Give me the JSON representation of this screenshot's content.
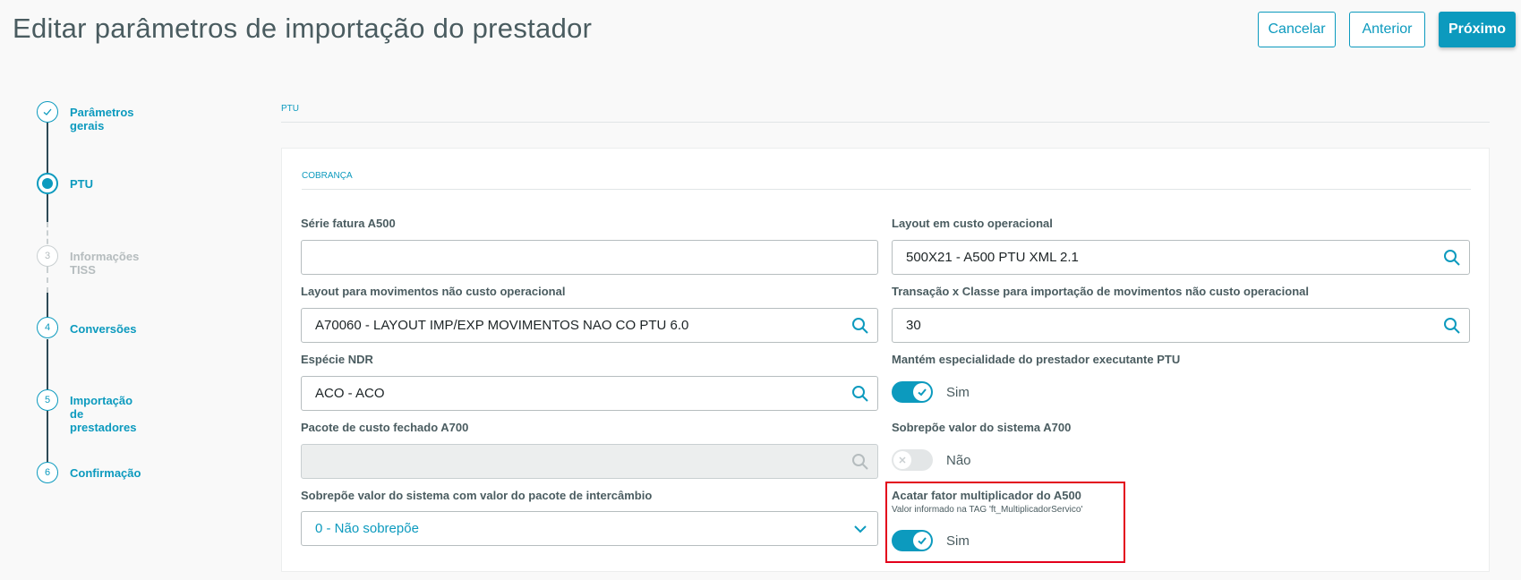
{
  "header": {
    "title": "Editar parâmetros de importação do prestador",
    "cancel_label": "Cancelar",
    "previous_label": "Anterior",
    "next_label": "Próximo"
  },
  "stepper": {
    "steps": [
      {
        "number": "✓",
        "label": "Parâmetros gerais",
        "state": "done"
      },
      {
        "number": "",
        "label": "PTU",
        "state": "active"
      },
      {
        "number": "3",
        "label": "Informações TISS",
        "state": "disabled"
      },
      {
        "number": "4",
        "label": "Conversões",
        "state": "pending"
      },
      {
        "number": "5",
        "label": "Importação de prestadores",
        "state": "pending"
      },
      {
        "number": "6",
        "label": "Confirmação",
        "state": "pending"
      }
    ]
  },
  "section": {
    "title": "PTU",
    "card_title": "COBRANÇA"
  },
  "form": {
    "serie_fatura": {
      "label": "Série fatura A500",
      "value": ""
    },
    "layout_custo": {
      "label": "Layout em custo operacional",
      "value": "500X21 - A500 PTU XML 2.1"
    },
    "layout_nao_custo": {
      "label": "Layout para movimentos não custo operacional",
      "value": "A70060 - LAYOUT IMP/EXP MOVIMENTOS NAO CO PTU 6.0"
    },
    "transacao_classe": {
      "label": "Transação x Classe para importação de movimentos não custo operacional",
      "value": "30"
    },
    "especie_ndr": {
      "label": "Espécie NDR",
      "value": "ACO - ACO"
    },
    "mantem_especialidade": {
      "label": "Mantém especialidade do prestador executante PTU",
      "state_label": "Sim"
    },
    "pacote_custo": {
      "label": "Pacote de custo fechado A700",
      "value": ""
    },
    "sobrepoe_a700": {
      "label": "Sobrepõe valor do sistema A700",
      "state_label": "Não"
    },
    "sobrepoe_pacote": {
      "label": "Sobrepõe valor do sistema com valor do pacote de intercâmbio",
      "value": "0 - Não sobrepõe"
    },
    "acatar_fator": {
      "label": "Acatar fator multiplicador do A500",
      "help": "Valor informado na TAG 'ft_MultiplicadorServico'",
      "state_label": "Sim"
    }
  },
  "colors": {
    "accent": "#0c9abe",
    "highlight": "#e3001b"
  }
}
